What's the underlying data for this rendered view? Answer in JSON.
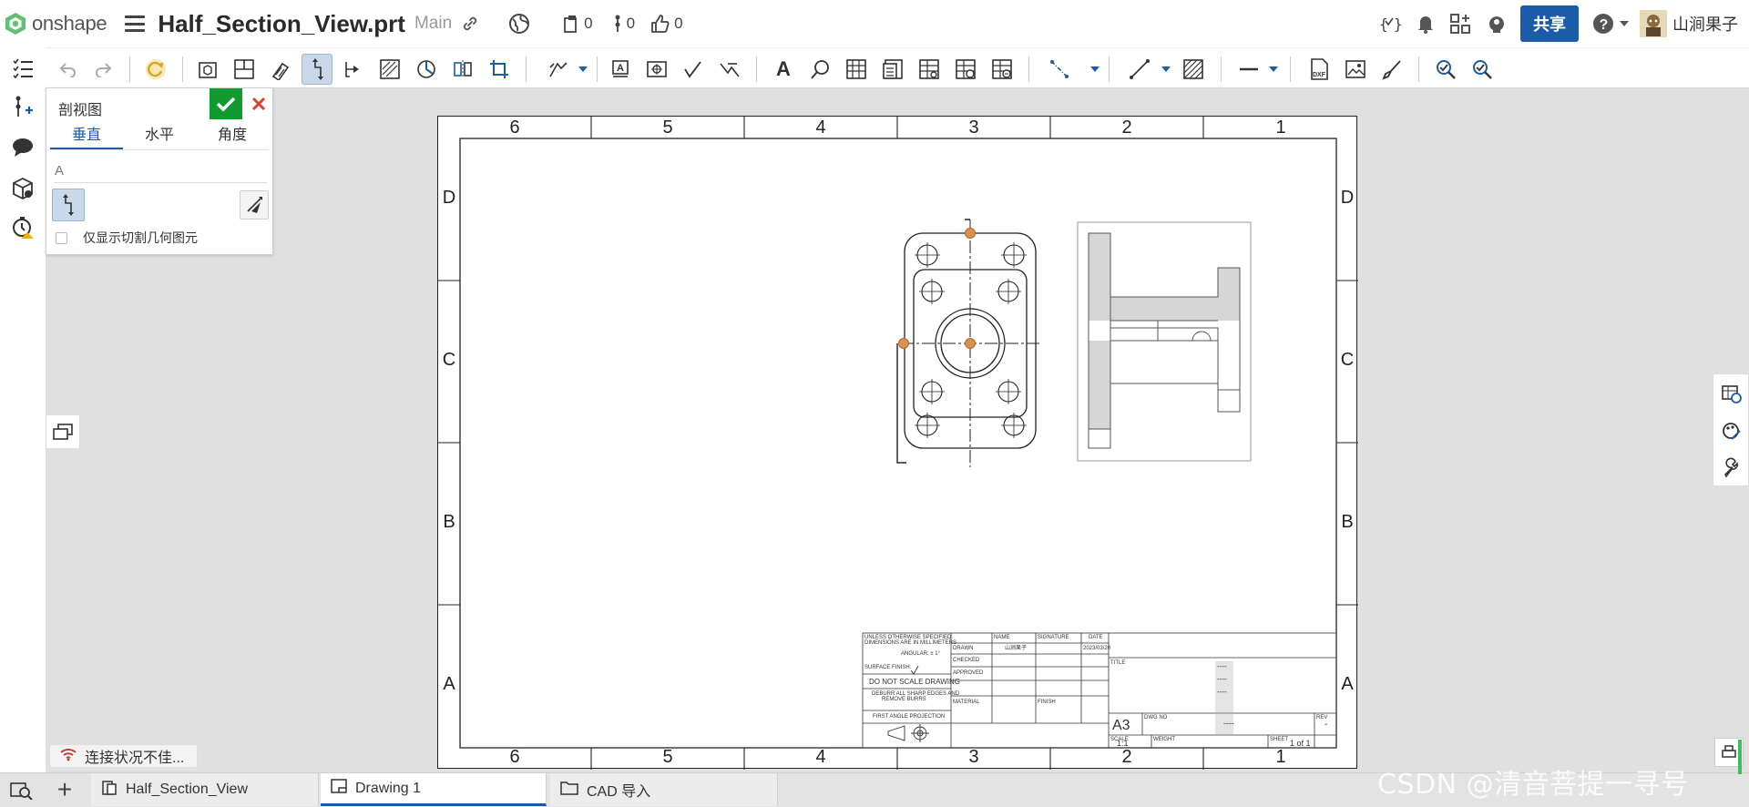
{
  "app": {
    "name": "onshape",
    "brand_color": "#1b5ca8"
  },
  "header": {
    "document_title": "Half_Section_View.prt",
    "branch": "Main",
    "versions_count": "0",
    "branches_count": "0",
    "likes_count": "0",
    "share_label": "共享",
    "user_name": "山涧果子"
  },
  "toolbar": {
    "icons": [
      "undo-icon",
      "redo-icon",
      "update-icon",
      "insert-view-icon",
      "projected-view-icon",
      "section-view-icon",
      "half-section-view-icon",
      "detail-view-icon",
      "break-view-icon",
      "broken-out-section-icon",
      "auxiliary-view-icon",
      "crop-view-icon",
      "dimension-icon",
      "note-icon",
      "datum-icon",
      "surface-finish-icon",
      "weld-icon",
      "text-icon",
      "callout-icon",
      "table-icon",
      "bom-icon",
      "hole-table-icon",
      "revision-table-icon",
      "inspection-icon",
      "centerline-icon",
      "sketch-line-icon",
      "hatch-icon",
      "line-style-icon",
      "dxf-export-icon",
      "image-icon",
      "format-painter-icon",
      "view-check-icon",
      "view-uncheck-icon"
    ]
  },
  "dialog": {
    "title": "剖视图",
    "tabs": [
      "垂直",
      "水平",
      "角度"
    ],
    "active_tab": "垂直",
    "field_value": "A",
    "checkbox_label": "仅显示切割几何图元"
  },
  "drawing": {
    "zone_columns": [
      "6",
      "5",
      "4",
      "3",
      "2",
      "1"
    ],
    "zone_rows": [
      "D",
      "C",
      "B",
      "A"
    ],
    "title_block": {
      "note1": "UNLESS OTHERWISE SPECIFIED:",
      "note2": "DIMENSIONS ARE IN MILLIMETERS",
      "angular": "ANGULAR: ± 1°",
      "surface_finish": "SURFACE FINISH:",
      "do_not_scale": "DO NOT SCALE DRAWING",
      "deburr1": "DEBURR ALL SHARP EDGES AND",
      "deburr2": "REMOVE BURRS",
      "projection": "FIRST ANGLE PROJECTION",
      "name_h": "NAME",
      "signature_h": "SIGNATURE",
      "date_h": "DATE",
      "drawn": "DRAWN",
      "drawn_name": "山涧果子",
      "drawn_date": "2023/03/20",
      "checked": "CHECKED",
      "approved": "APPROVED",
      "material": "MATERIAL",
      "finish": "FINISH",
      "title_h": "TITLE",
      "size": "A3",
      "dwg_no_h": "DWG NO",
      "rev_h": "REV",
      "rev_val": "-",
      "dwg_no_val": "----",
      "title_val1": "----",
      "title_val2": "----",
      "title_val3": "----",
      "scale_h": "SCALE",
      "scale_val": "1:1",
      "weight_h": "WEIGHT",
      "sheet_h": "SHEET",
      "sheet_val": "1 of 1"
    }
  },
  "status": {
    "connection_text": "连接状况不佳..."
  },
  "tabs": [
    {
      "label": "Half_Section_View",
      "icon": "part-studio-icon"
    },
    {
      "label": "Drawing 1",
      "icon": "drawing-icon",
      "active": true
    },
    {
      "label": "CAD 导入",
      "icon": "folder-icon"
    }
  ],
  "watermark": "CSDN @清音菩提一寻号"
}
